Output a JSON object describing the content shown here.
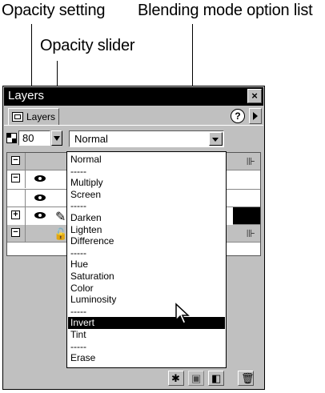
{
  "callouts": {
    "opacity_setting": "Opacity setting",
    "opacity_slider": "Opacity slider",
    "blending_mode_list": "Blending mode option list"
  },
  "panel": {
    "title": "Layers",
    "close_glyph": "×",
    "tab_label": "Layers",
    "help_glyph": "?"
  },
  "opacity": {
    "value": "80"
  },
  "blend": {
    "selected": "Normal",
    "options": [
      "Normal",
      "-----",
      "Multiply",
      "Screen",
      "-----",
      "Darken",
      "Lighten",
      "Difference",
      "-----",
      "Hue",
      "Saturation",
      "Color",
      "Luminosity",
      "-----",
      "Invert",
      "Tint",
      "-----",
      "Erase"
    ],
    "highlighted": "Invert"
  },
  "layers": {
    "rows": [
      {
        "expander": "−",
        "style": "gray"
      },
      {
        "expander": "−",
        "style": "white"
      },
      {
        "expander": "",
        "style": "white"
      },
      {
        "expander": "+",
        "style": "black"
      },
      {
        "expander": "−",
        "style": "gray"
      }
    ]
  },
  "bottom_bar": {
    "icons": [
      "new-layer-icon",
      "share-layer-icon",
      "new-frame-icon",
      "trash-icon"
    ]
  }
}
